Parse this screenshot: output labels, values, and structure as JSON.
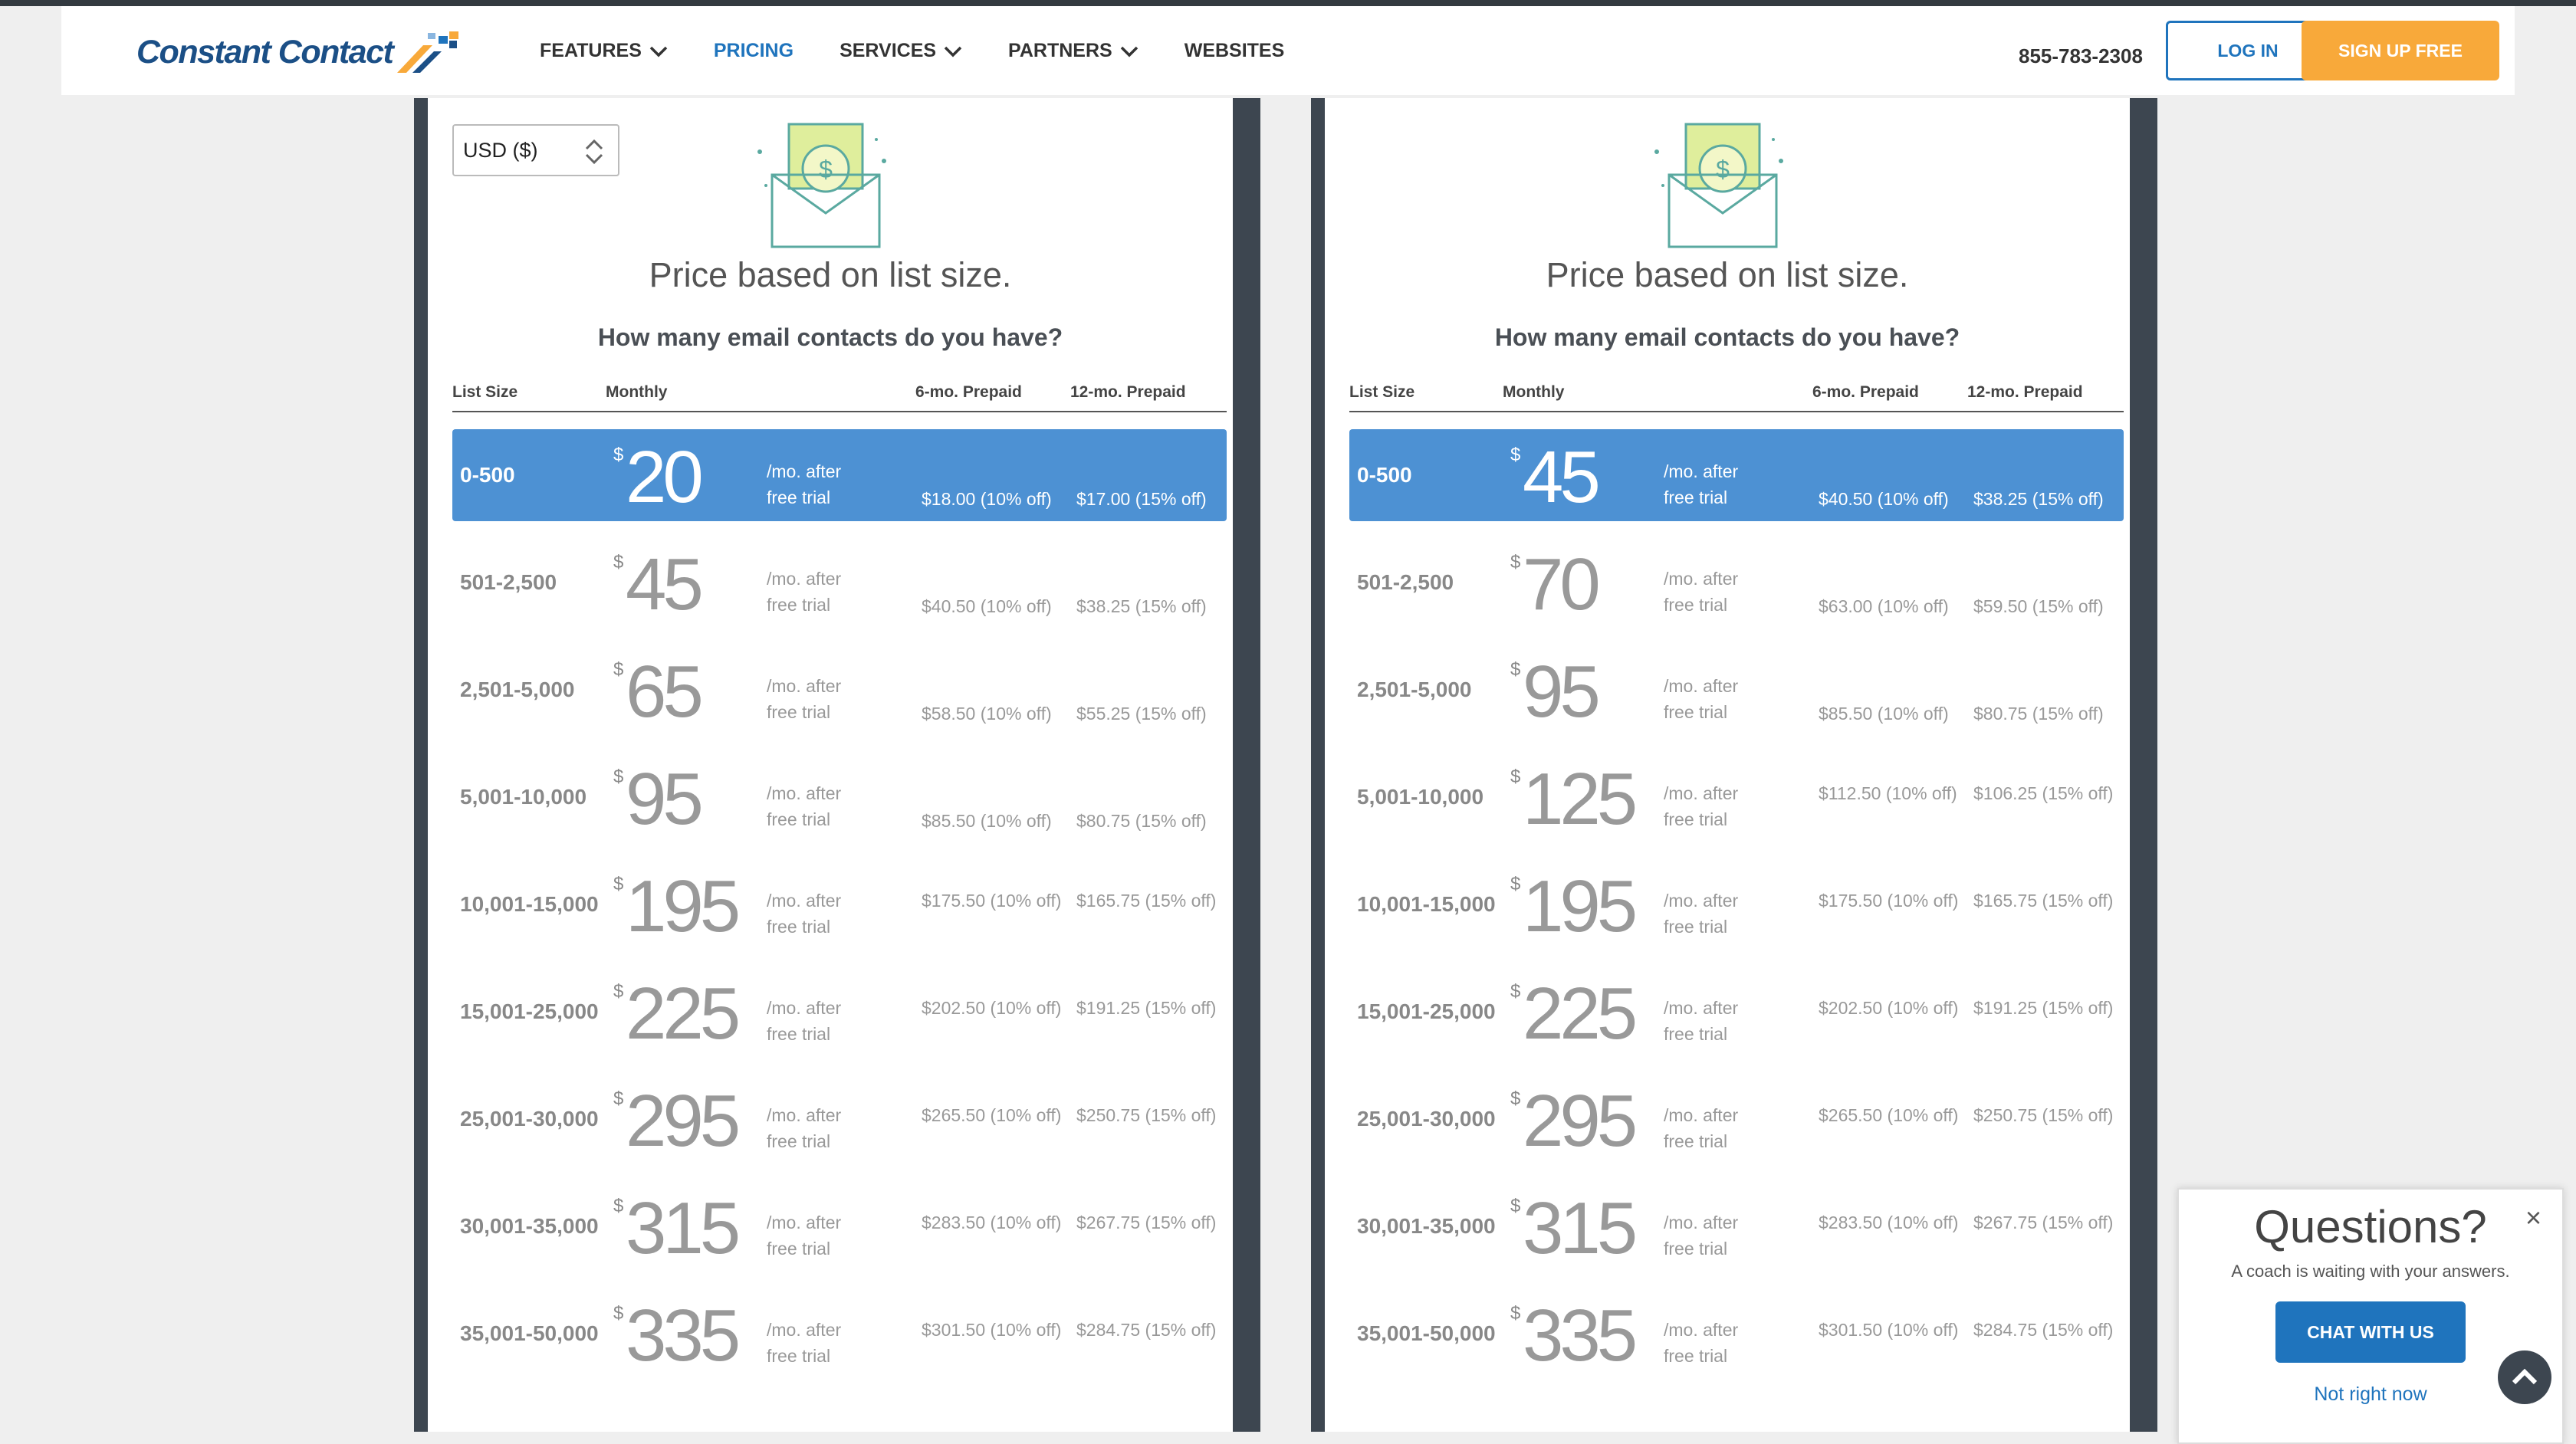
{
  "header": {
    "logo_text": "Constant Contact",
    "nav": [
      {
        "label": "FEATURES",
        "has_dropdown": true,
        "active": false
      },
      {
        "label": "PRICING",
        "has_dropdown": false,
        "active": true
      },
      {
        "label": "SERVICES",
        "has_dropdown": true,
        "active": false
      },
      {
        "label": "PARTNERS",
        "has_dropdown": true,
        "active": false
      },
      {
        "label": "WEBSITES",
        "has_dropdown": false,
        "active": false
      }
    ],
    "phone": "855-783-2308",
    "login_label": "LOG IN",
    "signup_label": "SIGN UP FREE"
  },
  "colors": {
    "accent": "#1f74bd",
    "signup": "#f8a93a",
    "selected_row": "#4d91d3",
    "panel_frame": "#3d4650"
  },
  "panels": [
    {
      "currency": "USD ($)",
      "heading": "Price based on list size.",
      "question": "How many email contacts do you have?",
      "columns": {
        "size": "List Size",
        "monthly": "Monthly",
        "six": "6-mo. Prepaid",
        "twelve": "12-mo. Prepaid"
      },
      "rows": [
        {
          "size": "0-500",
          "cur": "$",
          "price": "20",
          "note1": "/mo. after",
          "note2": "free trial",
          "p6": "$18.00 (10% off)",
          "p12": "$17.00 (15% off)",
          "selected": true
        },
        {
          "size": "501-2,500",
          "cur": "$",
          "price": "45",
          "note1": "/mo. after",
          "note2": "free trial",
          "p6": "$40.50 (10% off)",
          "p12": "$38.25 (15% off)"
        },
        {
          "size": "2,501-5,000",
          "cur": "$",
          "price": "65",
          "note1": "/mo. after",
          "note2": "free trial",
          "p6": "$58.50 (10% off)",
          "p12": "$55.25 (15% off)"
        },
        {
          "size": "5,001-10,000",
          "cur": "$",
          "price": "95",
          "note1": "/mo. after",
          "note2": "free trial",
          "p6": "$85.50 (10% off)",
          "p12": "$80.75 (15% off)"
        },
        {
          "size": "10,001-15,000",
          "cur": "$",
          "price": "195",
          "note1": "/mo. after",
          "note2": "free trial",
          "p6": "$175.50 (10% off)",
          "p12": "$165.75 (15% off)"
        },
        {
          "size": "15,001-25,000",
          "cur": "$",
          "price": "225",
          "note1": "/mo. after",
          "note2": "free trial",
          "p6": "$202.50 (10% off)",
          "p12": "$191.25 (15% off)"
        },
        {
          "size": "25,001-30,000",
          "cur": "$",
          "price": "295",
          "note1": "/mo. after",
          "note2": "free trial",
          "p6": "$265.50 (10% off)",
          "p12": "$250.75 (15% off)"
        },
        {
          "size": "30,001-35,000",
          "cur": "$",
          "price": "315",
          "note1": "/mo. after",
          "note2": "free trial",
          "p6": "$283.50 (10% off)",
          "p12": "$267.75 (15% off)"
        },
        {
          "size": "35,001-50,000",
          "cur": "$",
          "price": "335",
          "note1": "/mo. after",
          "note2": "free trial",
          "p6": "$301.50 (10% off)",
          "p12": "$284.75 (15% off)"
        }
      ]
    },
    {
      "heading": "Price based on list size.",
      "question": "How many email contacts do you have?",
      "columns": {
        "size": "List Size",
        "monthly": "Monthly",
        "six": "6-mo. Prepaid",
        "twelve": "12-mo. Prepaid"
      },
      "rows": [
        {
          "size": "0-500",
          "cur": "$",
          "price": "45",
          "note1": "/mo. after",
          "note2": "free trial",
          "p6": "$40.50 (10% off)",
          "p12": "$38.25 (15% off)",
          "selected": true
        },
        {
          "size": "501-2,500",
          "cur": "$",
          "price": "70",
          "note1": "/mo. after",
          "note2": "free trial",
          "p6": "$63.00 (10% off)",
          "p12": "$59.50 (15% off)"
        },
        {
          "size": "2,501-5,000",
          "cur": "$",
          "price": "95",
          "note1": "/mo. after",
          "note2": "free trial",
          "p6": "$85.50 (10% off)",
          "p12": "$80.75 (15% off)"
        },
        {
          "size": "5,001-10,000",
          "cur": "$",
          "price": "125",
          "note1": "/mo. after",
          "note2": "free trial",
          "p6": "$112.50 (10% off)",
          "p12": "$106.25 (15% off)"
        },
        {
          "size": "10,001-15,000",
          "cur": "$",
          "price": "195",
          "note1": "/mo. after",
          "note2": "free trial",
          "p6": "$175.50 (10% off)",
          "p12": "$165.75 (15% off)"
        },
        {
          "size": "15,001-25,000",
          "cur": "$",
          "price": "225",
          "note1": "/mo. after",
          "note2": "free trial",
          "p6": "$202.50 (10% off)",
          "p12": "$191.25 (15% off)"
        },
        {
          "size": "25,001-30,000",
          "cur": "$",
          "price": "295",
          "note1": "/mo. after",
          "note2": "free trial",
          "p6": "$265.50 (10% off)",
          "p12": "$250.75 (15% off)"
        },
        {
          "size": "30,001-35,000",
          "cur": "$",
          "price": "315",
          "note1": "/mo. after",
          "note2": "free trial",
          "p6": "$283.50 (10% off)",
          "p12": "$267.75 (15% off)"
        },
        {
          "size": "35,001-50,000",
          "cur": "$",
          "price": "335",
          "note1": "/mo. after",
          "note2": "free trial",
          "p6": "$301.50 (10% off)",
          "p12": "$284.75 (15% off)"
        }
      ]
    }
  ],
  "chat": {
    "title": "Questions?",
    "subtitle": "A coach is waiting with your answers.",
    "button_label": "CHAT WITH US",
    "dismiss_label": "Not right now",
    "close_glyph": "×"
  }
}
